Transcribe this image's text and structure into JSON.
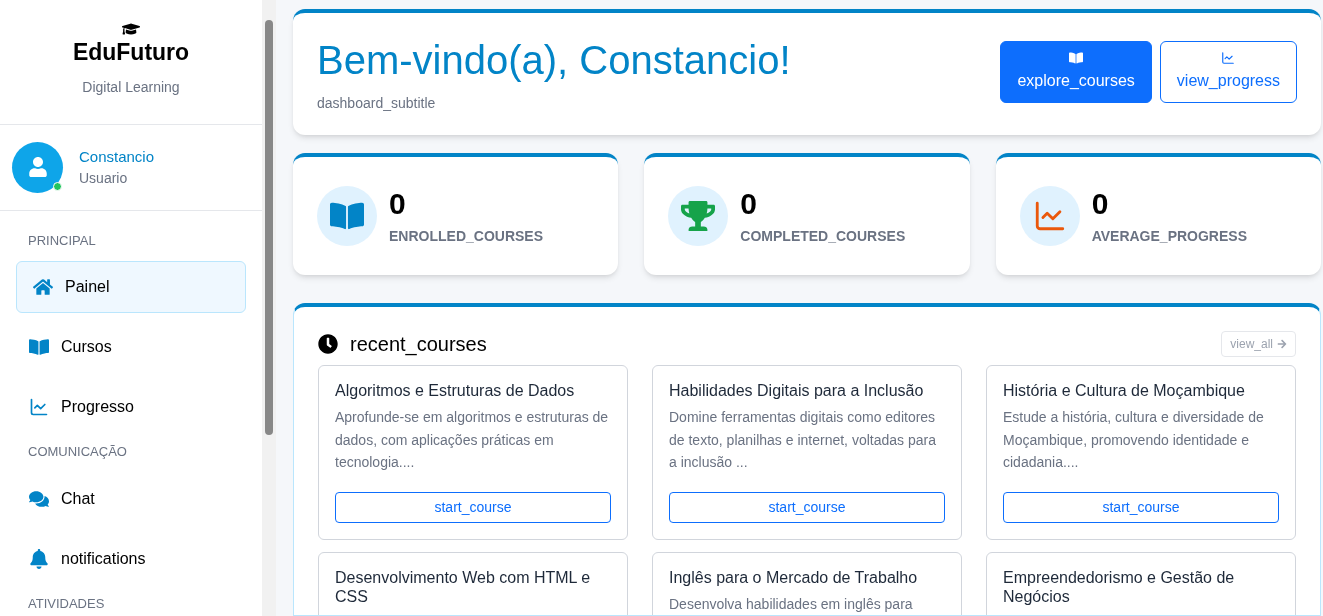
{
  "sidebar": {
    "brand": "EduFuturo",
    "tagline": "Digital Learning",
    "user": {
      "name": "Constancio",
      "role": "Usuario",
      "online": true
    },
    "sections": [
      {
        "title": "PRINCIPAL",
        "items": [
          {
            "label": "Painel",
            "kind": "home",
            "selected": true
          },
          {
            "label": "Cursos",
            "kind": "book",
            "selected": false
          },
          {
            "label": "Progresso",
            "kind": "chart",
            "selected": false
          }
        ]
      },
      {
        "title": "COMUNICAÇÃO",
        "items": [
          {
            "label": "Chat",
            "kind": "chat",
            "selected": false
          },
          {
            "label": "notifications",
            "kind": "bell",
            "selected": false
          }
        ]
      },
      {
        "title": "ATIVIDADES"
      }
    ]
  },
  "header": {
    "title": "Bem-vindo(a), Constancio!",
    "subtitle": "dashboard_subtitle",
    "buttons": [
      {
        "label": "explore_courses",
        "kind": "book",
        "primary": true
      },
      {
        "label": "view_progress",
        "kind": "chart",
        "primary": false
      }
    ]
  },
  "stats": [
    {
      "value": "0",
      "label": "ENROLLED_COURSES",
      "kind": "book",
      "color": "#0284c7"
    },
    {
      "value": "0",
      "label": "COMPLETED_COURSES",
      "kind": "trophy",
      "color": "#16a34a"
    },
    {
      "value": "0",
      "label": "AVERAGE_PROGRESS",
      "kind": "chart",
      "color": "#ea580c"
    }
  ],
  "recent": {
    "title": "recent_courses",
    "view_all": "view_all",
    "courses": [
      {
        "title": "Algoritmos e Estruturas de Dados",
        "description": "Aprofunde-se em algoritmos e estruturas de dados, com aplicações práticas em tecnologia....",
        "button": "start_course"
      },
      {
        "title": "Habilidades Digitais para a Inclusão",
        "description": "Domine ferramentas digitais como editores de texto, planilhas e internet, voltadas para a inclusão ...",
        "button": "start_course"
      },
      {
        "title": "História e Cultura de Moçambique",
        "description": "Estude a história, cultura e diversidade de Moçambique, promovendo identidade e cidadania....",
        "button": "start_course"
      },
      {
        "title": "Desenvolvimento Web com HTML e CSS"
      },
      {
        "title": "Inglês para o Mercado de Trabalho",
        "description": "Desenvolva habilidades em inglês para"
      },
      {
        "title": "Empreendedorismo e Gestão de Negócios"
      }
    ]
  }
}
